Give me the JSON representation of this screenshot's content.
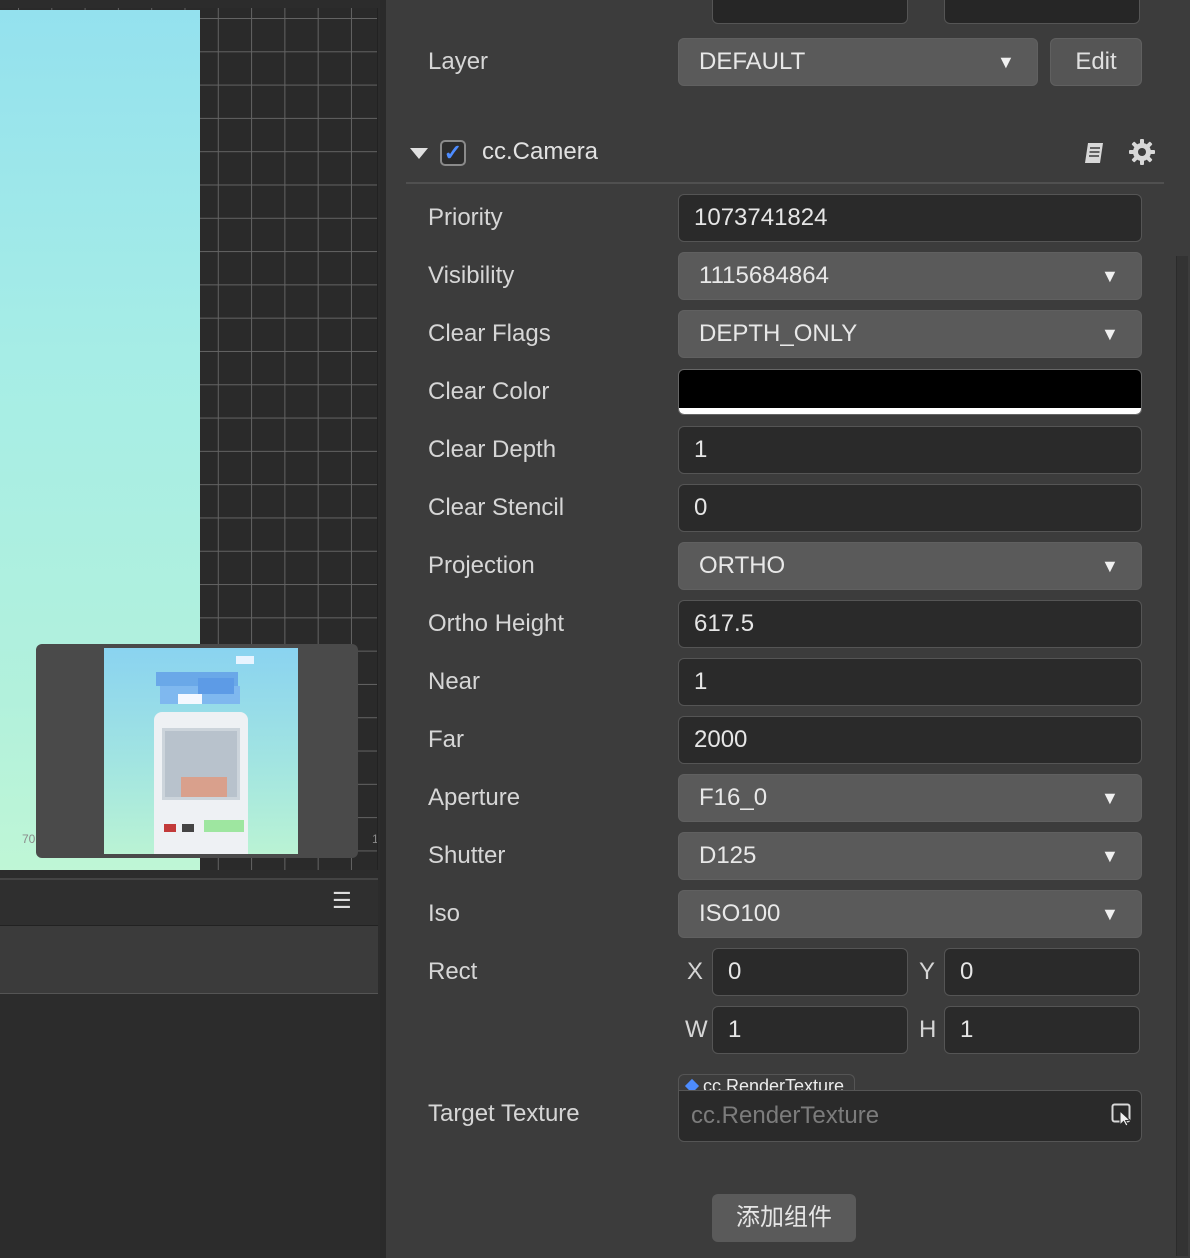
{
  "scene": {
    "axis_left_label": "70",
    "axis_right_label": "1"
  },
  "inspector": {
    "layer": {
      "label": "Layer",
      "value": "DEFAULT",
      "edit_label": "Edit"
    },
    "component": {
      "title": "cc.Camera",
      "enabled": true,
      "doc_icon": "book-icon",
      "settings_icon": "gear-icon"
    },
    "properties": {
      "priority": {
        "label": "Priority",
        "value": "1073741824"
      },
      "visibility": {
        "label": "Visibility",
        "value": "1115684864"
      },
      "clear_flags": {
        "label": "Clear Flags",
        "value": "DEPTH_ONLY"
      },
      "clear_color": {
        "label": "Clear Color",
        "color": "#000000"
      },
      "clear_depth": {
        "label": "Clear Depth",
        "value": "1"
      },
      "clear_stencil": {
        "label": "Clear Stencil",
        "value": "0"
      },
      "projection": {
        "label": "Projection",
        "value": "ORTHO"
      },
      "ortho_height": {
        "label": "Ortho Height",
        "value": "617.5"
      },
      "near": {
        "label": "Near",
        "value": "1"
      },
      "far": {
        "label": "Far",
        "value": "2000"
      },
      "aperture": {
        "label": "Aperture",
        "value": "F16_0"
      },
      "shutter": {
        "label": "Shutter",
        "value": "D125"
      },
      "iso": {
        "label": "Iso",
        "value": "ISO100"
      },
      "rect": {
        "label": "Rect",
        "x_label": "X",
        "x": "0",
        "y_label": "Y",
        "y": "0",
        "w_label": "W",
        "w": "1",
        "h_label": "H",
        "h": "1"
      },
      "target_texture": {
        "label": "Target Texture",
        "asset_type": "cc.RenderTexture",
        "placeholder": "cc.RenderTexture"
      }
    },
    "add_component_label": "添加组件"
  },
  "colors": {
    "accent": "#4d8cff",
    "panel_bg": "#3c3c3c",
    "field_bg": "#2a2a2a",
    "select_bg": "#5a5a5a"
  }
}
